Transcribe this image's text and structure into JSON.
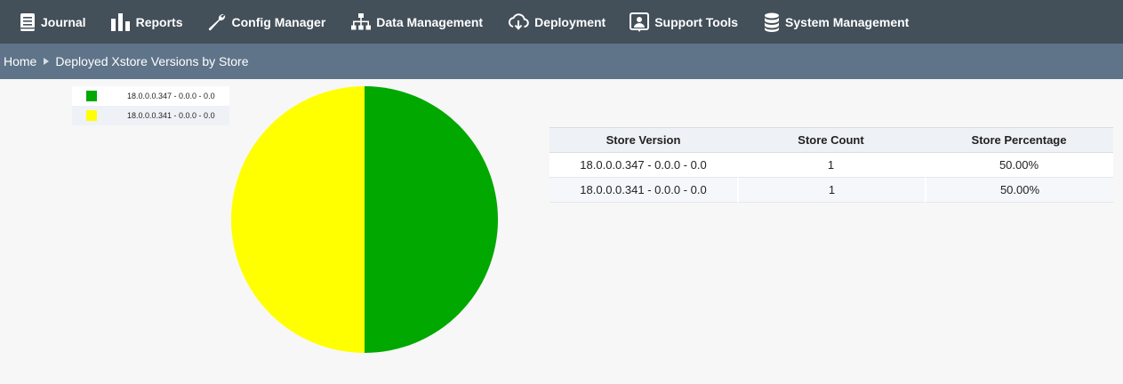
{
  "nav": {
    "items": [
      {
        "label": "Journal",
        "icon": "journal-icon"
      },
      {
        "label": "Reports",
        "icon": "bar-chart-icon"
      },
      {
        "label": "Config Manager",
        "icon": "wrench-icon"
      },
      {
        "label": "Data Management",
        "icon": "sitemap-icon"
      },
      {
        "label": "Deployment",
        "icon": "cloud-download-icon"
      },
      {
        "label": "Support Tools",
        "icon": "user-support-icon"
      },
      {
        "label": "System Management",
        "icon": "database-icon"
      }
    ]
  },
  "breadcrumb": {
    "home": "Home",
    "current": "Deployed Xstore Versions by Store"
  },
  "chart_data": {
    "type": "pie",
    "title": "",
    "legend_position": "top-left",
    "slices": [
      {
        "label": "18.0.0.0.347 - 0.0.0 - 0.0",
        "value": 1,
        "color": "#00a800"
      },
      {
        "label": "18.0.0.0.341 - 0.0.0 - 0.0",
        "value": 1,
        "color": "#ffff00"
      }
    ]
  },
  "table": {
    "headers": [
      "Store Version",
      "Store Count",
      "Store Percentage"
    ],
    "rows": [
      [
        "18.0.0.0.347 - 0.0.0 - 0.0",
        "1",
        "50.00%"
      ],
      [
        "18.0.0.0.341 - 0.0.0 - 0.0",
        "1",
        "50.00%"
      ]
    ]
  },
  "colors": {
    "nav_bg": "#434f59",
    "breadcrumb_bg": "#5f7489",
    "page_bg": "#f7f7f7"
  }
}
